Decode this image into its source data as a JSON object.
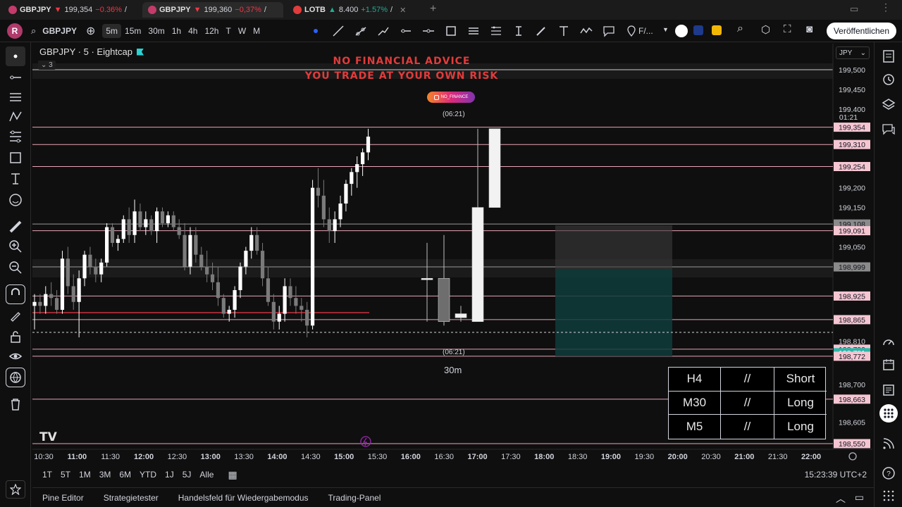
{
  "browser_tabs": [
    {
      "symbol": "GBPJPY",
      "arrow": "▼",
      "price": "199,354",
      "change": "−0.36%",
      "sep": "/"
    },
    {
      "symbol": "GBPJPY",
      "arrow": "▼",
      "price": "199,360",
      "change": "−0,37%",
      "sep": "/"
    },
    {
      "symbol": "LOTB",
      "arrow": "▲",
      "price": "8.400",
      "change": "+1.57%",
      "sep": "/"
    }
  ],
  "toolbar": {
    "avatar": "R",
    "symbol": "GBPJPY",
    "timeframes": [
      "5m",
      "15m",
      "30m",
      "1h",
      "4h",
      "12h",
      "T",
      "W",
      "M"
    ],
    "active_timeframe": "5m",
    "fx_label": "F/...",
    "publish": "Veröffentlichen"
  },
  "chart": {
    "legend": "GBPJPY · 5 · Eightcap",
    "collapse_count": "3",
    "warning_1": "NO FINANCIAL ADVICE",
    "warning_2": "YOU TRADE AT YOUR OWN RISK",
    "ig_handle": "NO_FINANCE",
    "timer_top": "(06:21)",
    "timer_bottom": "(06:21)",
    "interval_label": "30m",
    "currency": "JPY",
    "countdown": "01:21"
  },
  "chart_data": {
    "type": "candlestick",
    "price_axis": [
      "199,500",
      "199,450",
      "199,400",
      "199,200",
      "199,150",
      "199,050",
      "198,810",
      "198,700",
      "198,605"
    ],
    "price_labels": [
      {
        "value": "199,354",
        "kind": "pink"
      },
      {
        "value": "199,310",
        "kind": "pink"
      },
      {
        "value": "199,254",
        "kind": "pink"
      },
      {
        "value": "199,108",
        "kind": "gray"
      },
      {
        "value": "199,091",
        "kind": "pink"
      },
      {
        "value": "198,999",
        "kind": "gray"
      },
      {
        "value": "198,925",
        "kind": "pink"
      },
      {
        "value": "198,865",
        "kind": "pink"
      },
      {
        "value": "198,790",
        "kind": "pink"
      },
      {
        "value": "198,781",
        "kind": "teal"
      },
      {
        "value": "198,772",
        "kind": "pink"
      },
      {
        "value": "198,663",
        "kind": "pink"
      },
      {
        "value": "198,550",
        "kind": "pink"
      }
    ],
    "time_axis": [
      "10:30",
      "11:00",
      "11:30",
      "12:00",
      "12:30",
      "13:00",
      "13:30",
      "14:00",
      "14:30",
      "15:00",
      "15:30",
      "16:00",
      "16:30",
      "17:00",
      "17:30",
      "18:00",
      "18:30",
      "19:00",
      "19:30",
      "20:00",
      "20:30",
      "21:00",
      "21:30",
      "22:00"
    ],
    "bold_times": [
      "11:00",
      "12:00",
      "13:00",
      "14:00",
      "15:00",
      "16:00",
      "17:00",
      "18:00",
      "19:00",
      "20:00",
      "21:00",
      "22:00"
    ],
    "candles_5m": [
      [
        198.9,
        198.93,
        198.84,
        198.91
      ],
      [
        198.91,
        198.93,
        198.88,
        198.9
      ],
      [
        198.9,
        198.95,
        198.88,
        198.93
      ],
      [
        198.93,
        198.96,
        198.9,
        198.92
      ],
      [
        198.92,
        198.94,
        198.88,
        198.89
      ],
      [
        198.89,
        199.04,
        198.88,
        199.02
      ],
      [
        199.02,
        199.05,
        198.93,
        198.95
      ],
      [
        198.95,
        198.98,
        198.89,
        198.91
      ],
      [
        198.91,
        198.99,
        198.82,
        198.97
      ],
      [
        198.97,
        199.04,
        198.95,
        199.03
      ],
      [
        199.03,
        199.05,
        198.98,
        199.0
      ],
      [
        199.0,
        199.02,
        198.96,
        198.98
      ],
      [
        198.98,
        199.02,
        198.96,
        199.01
      ],
      [
        199.01,
        199.11,
        199.0,
        199.1
      ],
      [
        199.1,
        199.11,
        199.05,
        199.06
      ],
      [
        199.06,
        199.08,
        199.04,
        199.07
      ],
      [
        199.07,
        199.13,
        199.06,
        199.12
      ],
      [
        199.12,
        199.15,
        199.06,
        199.08
      ],
      [
        199.08,
        199.17,
        199.06,
        199.14
      ],
      [
        199.14,
        199.16,
        199.09,
        199.1
      ],
      [
        199.1,
        199.14,
        199.08,
        199.12
      ],
      [
        199.12,
        199.13,
        199.08,
        199.09
      ],
      [
        199.09,
        199.15,
        199.06,
        199.14
      ],
      [
        199.14,
        199.15,
        199.1,
        199.11
      ],
      [
        199.11,
        199.14,
        199.1,
        199.13
      ],
      [
        199.13,
        199.14,
        199.09,
        199.1
      ],
      [
        199.1,
        199.12,
        199.07,
        199.08
      ],
      [
        199.08,
        199.11,
        198.99,
        199.0
      ],
      [
        199.0,
        199.1,
        198.98,
        199.08
      ],
      [
        199.08,
        199.1,
        199.01,
        199.03
      ],
      [
        199.03,
        199.05,
        198.99,
        199.0
      ],
      [
        199.0,
        199.04,
        198.96,
        198.98
      ],
      [
        198.98,
        199.01,
        198.94,
        198.96
      ],
      [
        198.96,
        199.0,
        198.9,
        198.92
      ],
      [
        198.92,
        198.93,
        198.87,
        198.88
      ],
      [
        198.88,
        198.9,
        198.86,
        198.89
      ],
      [
        198.89,
        198.95,
        198.87,
        198.94
      ],
      [
        198.94,
        199.01,
        198.92,
        199.0
      ],
      [
        199.0,
        199.05,
        198.98,
        199.04
      ],
      [
        199.04,
        199.1,
        199.02,
        199.08
      ],
      [
        199.08,
        199.1,
        199.03,
        199.04
      ],
      [
        199.04,
        199.06,
        198.95,
        198.97
      ],
      [
        198.97,
        199.0,
        198.9,
        198.91
      ],
      [
        198.91,
        198.93,
        198.84,
        198.86
      ],
      [
        198.86,
        198.9,
        198.84,
        198.88
      ],
      [
        198.88,
        198.97,
        198.86,
        198.95
      ],
      [
        198.95,
        198.97,
        198.9,
        198.92
      ],
      [
        198.92,
        198.95,
        198.88,
        198.9
      ],
      [
        198.9,
        198.92,
        198.86,
        198.89
      ],
      [
        198.89,
        198.91,
        198.82,
        198.85
      ],
      [
        198.85,
        199.22,
        198.84,
        199.2
      ],
      [
        199.2,
        199.25,
        199.15,
        199.18
      ],
      [
        199.18,
        199.22,
        199.1,
        199.12
      ],
      [
        199.12,
        199.15,
        199.06,
        199.09
      ],
      [
        199.09,
        199.14,
        199.06,
        199.12
      ],
      [
        199.12,
        199.18,
        199.1,
        199.16
      ],
      [
        199.16,
        199.22,
        199.14,
        199.21
      ],
      [
        199.21,
        199.25,
        199.18,
        199.24
      ],
      [
        199.24,
        199.28,
        199.2,
        199.26
      ],
      [
        199.26,
        199.3,
        199.23,
        199.29
      ],
      [
        199.29,
        199.35,
        199.27,
        199.33
      ]
    ],
    "candles_30m": [
      [
        198.97,
        199.06,
        198.86,
        198.97
      ],
      [
        198.97,
        199.08,
        198.85,
        198.86
      ],
      [
        198.87,
        198.9,
        198.86,
        198.88
      ],
      [
        198.86,
        199.35,
        198.86,
        199.15
      ],
      [
        199.15,
        199.35,
        199.15,
        199.35
      ]
    ],
    "signals": [
      {
        "tf": "H4",
        "sep": "//",
        "dir": "Short"
      },
      {
        "tf": "M30",
        "sep": "//",
        "dir": "Long"
      },
      {
        "tf": "M5",
        "sep": "//",
        "dir": "Long"
      }
    ]
  },
  "range_bar": {
    "ranges": [
      "1T",
      "5T",
      "1M",
      "3M",
      "6M",
      "YTD",
      "1J",
      "5J",
      "Alle"
    ],
    "clock": "15:23:39 UTC+2"
  },
  "bottom_panels": [
    "Pine Editor",
    "Strategietester",
    "Handelsfeld für Wiedergabemodus",
    "Trading-Panel"
  ],
  "colors": {
    "pink_line": "#e8a4b6",
    "red_line": "#f23645",
    "teal": "#2bb5a8",
    "background": "#0f0f0f"
  }
}
